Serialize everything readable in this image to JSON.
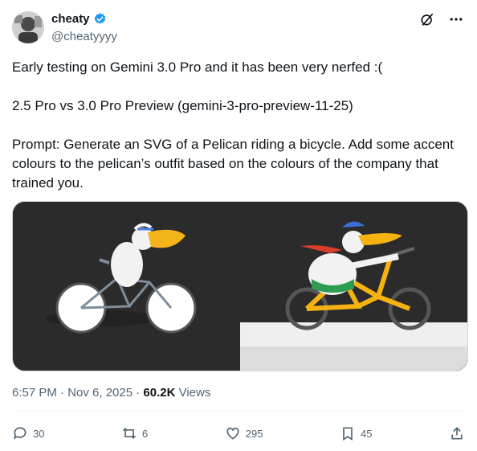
{
  "user": {
    "display_name": "cheaty",
    "handle": "@cheatyyyy"
  },
  "post": {
    "text": [
      "Early testing on Gemini 3.0 Pro and it has been very nerfed :(",
      "2.5 Pro vs 3.0 Pro Preview (gemini-3-pro-preview-11-25)",
      "Prompt: Generate an SVG of a Pelican riding a bicycle. Add some accent colours to the pelican’s outfit based on the colours of the company that trained you."
    ],
    "timestamp": "6:57 PM · Nov 6, 2025 · ",
    "views_count": "60.2K",
    "views_label": " Views"
  },
  "actions": {
    "replies": "30",
    "reposts": "6",
    "likes": "295",
    "bookmarks": "45"
  },
  "colors": {
    "verified": "#1d9bf0",
    "muted": "#536471",
    "media_bg": "#2a2a2a"
  },
  "icons": [
    "verified-badge-icon",
    "grok-icon",
    "more-icon",
    "reply-icon",
    "repost-icon",
    "like-icon",
    "bookmark-icon",
    "share-icon"
  ]
}
